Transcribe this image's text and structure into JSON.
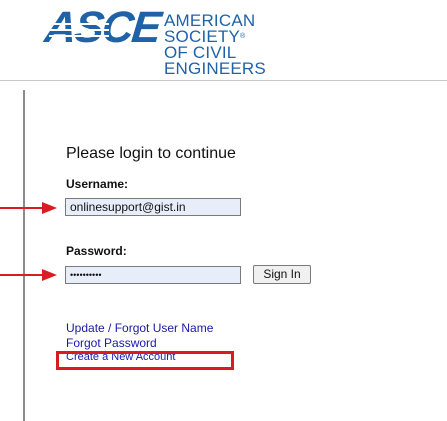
{
  "logo": {
    "mark": "ASCE",
    "line1": "AMERICAN SOCIETY",
    "reg_symbol": "®",
    "line2": "OF CIVIL ENGINEERS"
  },
  "form": {
    "heading": "Please login to continue",
    "username_label": "Username:",
    "username_value": "onlinesupport@gist.in",
    "password_label": "Password:",
    "password_value": "••••••••••",
    "signin_label": "Sign In"
  },
  "links": {
    "update_forgot_user": "Update / Forgot User Name",
    "forgot_password": "Forgot Password",
    "create_account": "Create a New Account"
  },
  "colors": {
    "brand": "#1f62a7",
    "annotation": "#d91c22",
    "link": "#1a1aa6"
  },
  "annotations": {
    "icons": [
      "arrow-right-icon",
      "arrow-right-icon"
    ]
  }
}
